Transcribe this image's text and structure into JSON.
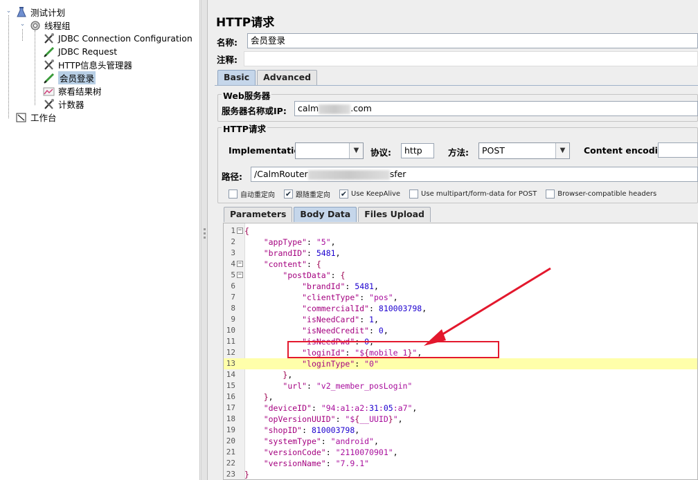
{
  "tree": {
    "items": [
      {
        "label": "测试计划",
        "icon": "test-plan-icon"
      },
      {
        "label": "线程组",
        "icon": "thread-group-icon"
      },
      {
        "label": "JDBC Connection Configuration",
        "icon": "config-wrench-icon"
      },
      {
        "label": "JDBC Request",
        "icon": "sampler-pen-icon"
      },
      {
        "label": "HTTP信息头管理器",
        "icon": "config-wrench-icon"
      },
      {
        "label": "会员登录",
        "icon": "sampler-pen-icon"
      },
      {
        "label": "察看结果树",
        "icon": "listener-chart-icon"
      },
      {
        "label": "计数器",
        "icon": "config-wrench-icon"
      },
      {
        "label": "工作台",
        "icon": "workbench-icon"
      }
    ],
    "toggles": {
      "open": "⌄"
    }
  },
  "panel": {
    "title": "HTTP请求",
    "name_label": "名称:",
    "name_value": "会员登录",
    "comment_label": "注释:",
    "tabs": [
      "Basic",
      "Advanced"
    ],
    "web_server": {
      "group_title": "Web服务器",
      "server_label": "服务器名称或IP:",
      "server_prefix": "calm",
      "server_suffix": ".com"
    },
    "http_request": {
      "group_title": "HTTP请求",
      "implementation_label": "Implementation:",
      "implementation_value": "",
      "protocol_label": "协议:",
      "protocol_value": "http",
      "method_label": "方法:",
      "method_value": "POST",
      "encoding_label": "Content encoding:",
      "path_label": "路径:",
      "path_prefix": "/CalmRouter",
      "path_suffix": "sfer"
    },
    "options": [
      {
        "label": "自动重定向",
        "checked": false
      },
      {
        "label": "跟随重定向",
        "checked": true
      },
      {
        "label": "Use KeepAlive",
        "checked": true
      },
      {
        "label": "Use multipart/form-data for POST",
        "checked": false
      },
      {
        "label": "Browser-compatible headers",
        "checked": false
      }
    ],
    "check_mark": "✔",
    "arrow_glyph": "▼",
    "body_tabs": [
      "Parameters",
      "Body Data",
      "Files Upload"
    ]
  },
  "editor": {
    "lines": [
      "{",
      "    \"appType\": \"5\",",
      "    \"brandID\": 5481,",
      "    \"content\": {",
      "        \"postData\": {",
      "            \"brandId\": 5481,",
      "            \"clientType\": \"pos\",",
      "            \"commercialId\": 810003798,",
      "            \"isNeedCard\": 1,",
      "            \"isNeedCredit\": 0,",
      "            \"isNeedPwd\": 0,",
      "            \"loginId\": \"${mobile_1}\",",
      "            \"loginType\": \"0\"",
      "        },",
      "        \"url\": \"v2_member_posLogin\"",
      "    },",
      "    \"deviceID\": \"94:a1:a2:31:05:a7\",",
      "    \"opVersionUUID\": \"${__UUID}\",",
      "    \"shopID\": 810003798,",
      "    \"systemType\": \"android\",",
      "    \"versionCode\": \"2110070901\",",
      "    \"versionName\": \"7.9.1\"",
      "}"
    ],
    "highlighted_line": 13,
    "fold_lines": [
      1,
      4,
      5
    ],
    "fold_glyph": "−"
  },
  "annotation": {
    "color": "#e3182d"
  }
}
